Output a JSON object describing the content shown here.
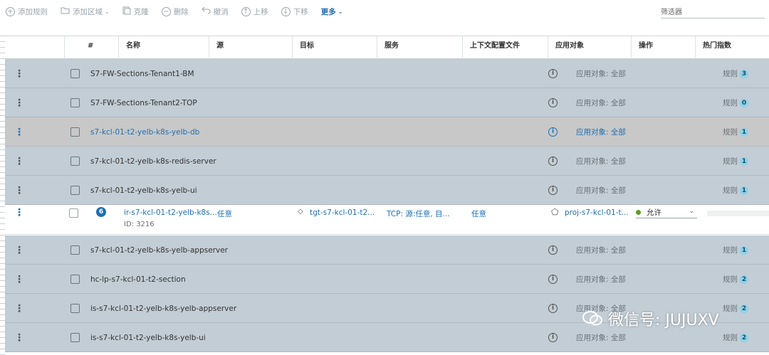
{
  "toolbar": {
    "add_rule": "添加规则",
    "add_section": "添加区域",
    "clone": "克隆",
    "delete": "删除",
    "undo": "撤消",
    "move_up": "上移",
    "move_down": "下移",
    "more": "更多",
    "filter_placeholder": "筛选器"
  },
  "columns": {
    "num": "#",
    "name": "名称",
    "source": "源",
    "destination": "目标",
    "services": "服务",
    "context_profiles": "上下文配置文件",
    "applied_to": "应用对象",
    "action": "操作",
    "hit_count": "热门指数"
  },
  "sections": [
    {
      "name": "S7-FW-Sections-Tenant1-BM",
      "applied_to": "应用对象: 全部",
      "rules_label": "规则",
      "rule_count": "3"
    },
    {
      "name": "S7-FW-Sections-Tenant2-TOP",
      "applied_to": "应用对象: 全部",
      "rules_label": "规则",
      "rule_count": "0"
    },
    {
      "name": "s7-kcl-01-t2-yelb-k8s-yelb-db",
      "applied_to": "应用对象: 全部",
      "rules_label": "规则",
      "rule_count": "1"
    },
    {
      "name": "s7-kcl-01-t2-yelb-k8s-redis-server",
      "applied_to": "应用对象: 全部",
      "rules_label": "规则",
      "rule_count": "1"
    },
    {
      "name": "s7-kcl-01-t2-yelb-k8s-yelb-ui",
      "applied_to": "应用对象: 全部",
      "rules_label": "规则",
      "rule_count": "1"
    },
    {
      "name": "s7-kcl-01-t2-yelb-k8s-yelb-appserver",
      "applied_to": "应用对象: 全部",
      "rules_label": "规则",
      "rule_count": "1"
    },
    {
      "name": "hc-lp-s7-kcl-01-t2-section",
      "applied_to": "应用对象: 全部",
      "rules_label": "规则",
      "rule_count": "2"
    },
    {
      "name": "is-s7-kcl-01-t2-yelb-k8s-yelb-appserver",
      "applied_to": "应用对象: 全部",
      "rules_label": "规则",
      "rule_count": "2"
    },
    {
      "name": "is-s7-kcl-01-t2-yelb-k8s-yelb-ui",
      "applied_to": "应用对象: 全部",
      "rules_label": "规则",
      "rule_count": "2"
    }
  ],
  "rule": {
    "number": "6",
    "name": "ir-s7-kcl-01-t2-yelb-k8s...",
    "id": "ID: 3216",
    "source": "任意",
    "destination": "tgt-s7-kcl-01-t2...",
    "services": "TCP: 源:任意, 目...",
    "context_profiles": "任意",
    "applied_to": "proj-s7-kcl-01-t...",
    "action": "允许"
  },
  "watermark": "微信号: JUJUXV",
  "colors": {
    "section_bg": "#c2cdd5",
    "selected_bg": "#c8c8c8",
    "link": "#1f6fb2",
    "badge": "#8fd1e8",
    "allow_dot": "#5aa220"
  }
}
